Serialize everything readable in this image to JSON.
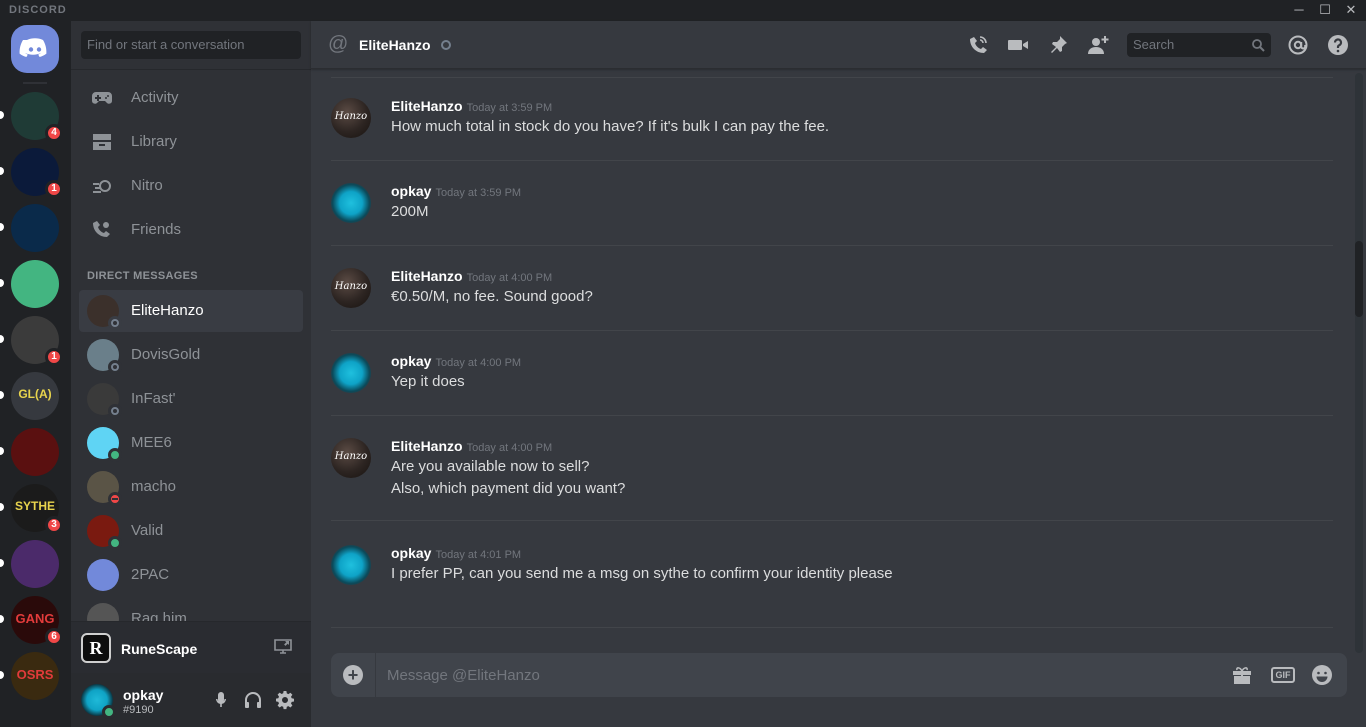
{
  "titlebar": {
    "brand": "DISCORD",
    "minimize": "─",
    "maximize": "☐",
    "close": "✕"
  },
  "guilds": [
    {
      "name": "home",
      "color": "#7289da",
      "badge": ""
    },
    {
      "name": "guild-1",
      "color": "#1f3b36",
      "badge": "4"
    },
    {
      "name": "guild-oprs",
      "color": "#0b1a3a",
      "badge": "1"
    },
    {
      "name": "guild-3",
      "color": "#0a2a4a",
      "badge": ""
    },
    {
      "name": "guild-bot",
      "color": "#43b581",
      "badge": ""
    },
    {
      "name": "guild-panda",
      "color": "#3b3b3b",
      "badge": "1"
    },
    {
      "name": "guild-gla",
      "color": "#36393f",
      "text": "GL(A)",
      "badge": ""
    },
    {
      "name": "guild-phoenix",
      "color": "#5a1010",
      "badge": ""
    },
    {
      "name": "guild-sythe",
      "color": "#1b1b1b",
      "text": "SYTHE",
      "badge": "3"
    },
    {
      "name": "guild-purple",
      "color": "#4b2a6a",
      "badge": ""
    },
    {
      "name": "guild-gang",
      "color": "#2a0a0a",
      "text": "GANG",
      "badge": "6"
    },
    {
      "name": "guild-osrs",
      "color": "#3a2a10",
      "text": "OSRS",
      "badge": ""
    }
  ],
  "dm": {
    "search_placeholder": "Find or start a conversation",
    "nav": [
      {
        "label": "Activity",
        "icon": "gamepad-icon"
      },
      {
        "label": "Library",
        "icon": "library-icon"
      },
      {
        "label": "Nitro",
        "icon": "nitro-icon"
      },
      {
        "label": "Friends",
        "icon": "friends-icon"
      }
    ],
    "header": "DIRECT MESSAGES",
    "items": [
      {
        "name": "EliteHanzo",
        "status": "offline",
        "avatar_color": "#3b302b"
      },
      {
        "name": "DovisGold",
        "status": "offline",
        "avatar_color": "#6a7f8a"
      },
      {
        "name": "InFast'",
        "status": "offline",
        "avatar_color": "#3a3a3a"
      },
      {
        "name": "MEE6",
        "status": "online",
        "avatar_color": "#5fd4f4"
      },
      {
        "name": "macho",
        "status": "dnd",
        "avatar_color": "#5a5446"
      },
      {
        "name": "Valid",
        "status": "online",
        "avatar_color": "#7a1a10"
      },
      {
        "name": "2PAC",
        "status": "",
        "avatar_color": "#7289da"
      },
      {
        "name": "Rag him",
        "status": "",
        "avatar_color": "#555555"
      }
    ]
  },
  "activity": {
    "game": "RuneScape",
    "game_icon_letter": "R"
  },
  "user": {
    "name": "opkay",
    "tag": "#9190"
  },
  "chat": {
    "channel": "EliteHanzo",
    "search_placeholder": "Search",
    "composer_placeholder": "Message @EliteHanzo",
    "gif_label": "GIF",
    "messages": [
      {
        "author": "EliteHanzo",
        "avatar": "hanzo",
        "time": "Today at 3:59 PM",
        "lines": [
          "How much total in stock do you have? If it's bulk I can pay the fee."
        ]
      },
      {
        "author": "opkay",
        "avatar": "opkay",
        "time": "Today at 3:59 PM",
        "lines": [
          "200M"
        ]
      },
      {
        "author": "EliteHanzo",
        "avatar": "hanzo",
        "time": "Today at 4:00 PM",
        "lines": [
          "€0.50/M, no fee. Sound good?"
        ]
      },
      {
        "author": "opkay",
        "avatar": "opkay",
        "time": "Today at 4:00 PM",
        "lines": [
          "Yep it does"
        ]
      },
      {
        "author": "EliteHanzo",
        "avatar": "hanzo",
        "time": "Today at 4:00 PM",
        "lines": [
          "Are you available now to sell?",
          "Also, which payment did you want?"
        ]
      },
      {
        "author": "opkay",
        "avatar": "opkay",
        "time": "Today at 4:01 PM",
        "lines": [
          "I prefer PP, can you send me a msg on sythe to confirm your identity please"
        ]
      }
    ],
    "hanzo_avatar_text": "Hanzo"
  }
}
